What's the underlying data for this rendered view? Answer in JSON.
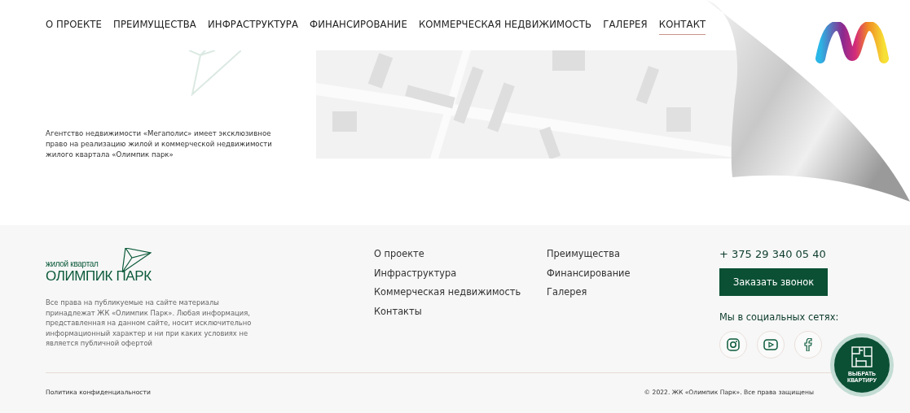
{
  "nav": [
    {
      "label": "О ПРОЕКТЕ",
      "selected": false
    },
    {
      "label": "ПРЕИМУЩЕСТВА",
      "selected": false
    },
    {
      "label": "ИНФРАСТРУКТУРА",
      "selected": false
    },
    {
      "label": "ФИНАНСИРОВАНИЕ",
      "selected": false
    },
    {
      "label": "КОММЕРЧЕСКАЯ НЕДВИЖИМОСТЬ",
      "selected": false
    },
    {
      "label": "ГАЛЕРЕЯ",
      "selected": false
    },
    {
      "label": "КОНТАКТ",
      "selected": true
    }
  ],
  "about": {
    "text": "Агентство недвижимости «Мегаполис» имеет эксклюзивное право на реализацию жилой и коммерческой недвижимости жилого квартала «Олимпик парк»"
  },
  "footer": {
    "logo": {
      "small": "жилой квартал",
      "big": "ОЛИМПИК ПАРК"
    },
    "disclaimer": "Все права на публикуемые на сайте материалы принадлежат ЖК «Олимпик Парк». Любая информация, представленная на данном сайте, носит исключительно информационный характер и ни при каких условиях не является публичной офертой",
    "links_1": [
      "О проекте",
      "Инфраструктура",
      "Коммерческая недвижимость",
      "Контакты"
    ],
    "links_2": [
      "Преимущества",
      "Финансирование",
      "Галерея"
    ],
    "phone": "+ 375 29 340 05 40",
    "call_button": "Заказать звонок",
    "social_title": "Мы в социальных сетях:",
    "social": [
      {
        "kind": "instagram"
      },
      {
        "kind": "youtube"
      },
      {
        "kind": "facebook"
      }
    ],
    "privacy": "Политика конфиденциальности",
    "copyright": "© 2022. ЖК «Олимпик Парк». Все права защищены",
    "pick_button": "ВЫБРАТЬ КВАРТИРУ"
  }
}
